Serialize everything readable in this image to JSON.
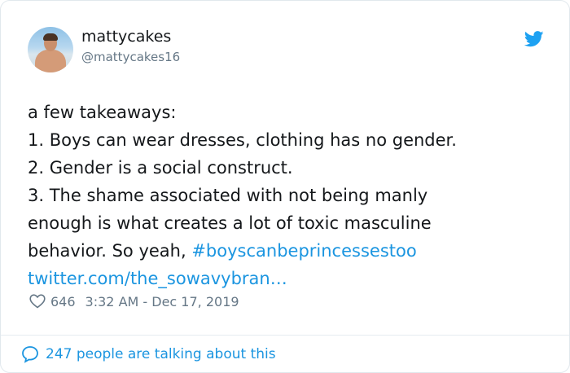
{
  "author": {
    "name": "mattycakes",
    "handle": "@mattycakes16"
  },
  "tweet": {
    "line1": "a few takeaways:",
    "line2": "1. Boys can wear dresses, clothing has no gender.",
    "line3": "2. Gender is a social construct.",
    "line4": "3. The shame associated with not being manly",
    "line5": "enough is what creates a lot of toxic masculine",
    "line6_text": "behavior. So yeah, ",
    "hashtag": "#boyscanbeprincessestoo",
    "url": "twitter.com/the_sowavybran…"
  },
  "meta": {
    "likes": "646",
    "timestamp": "3:32 AM - Dec 17, 2019"
  },
  "footer": {
    "talking": "247 people are talking about this"
  },
  "colors": {
    "link": "#1b95e0",
    "text": "#14171a",
    "secondary": "#657786"
  },
  "icons": {
    "logo": "twitter-bird-icon",
    "like": "heart-icon",
    "reply": "speech-bubble-icon"
  }
}
